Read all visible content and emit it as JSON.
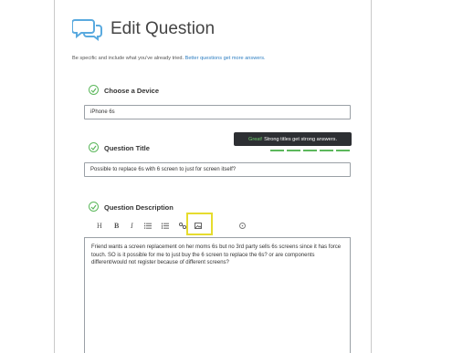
{
  "header": {
    "title": "Edit Question"
  },
  "intro": {
    "text": "Be specific and include what you've already tried.",
    "link": "Better questions get more answers."
  },
  "device": {
    "label": "Choose a Device",
    "value": "iPhone 6s"
  },
  "title_field": {
    "label": "Question Title",
    "value": "Possible to replace 6s with 6 screen to just for screen itself?"
  },
  "tooltip": {
    "prefix": "Great!",
    "text": "Strong titles get strong answers."
  },
  "description": {
    "label": "Question Description",
    "toolbar": {
      "heading": "H",
      "bold": "B",
      "italic": "I"
    },
    "value": "Friend wants a screen replacement on her moms 6s but no 3rd party sells 6s screens since it has force touch. SO is it possible for me to just buy the 6 screen to replace the 6s? or are components different/would not register because of different screens?"
  },
  "colors": {
    "accent": "#5cb85c",
    "link": "#2f7fc2",
    "highlight": "#e6dc2e",
    "tooltip_bg": "#2d2f33"
  }
}
